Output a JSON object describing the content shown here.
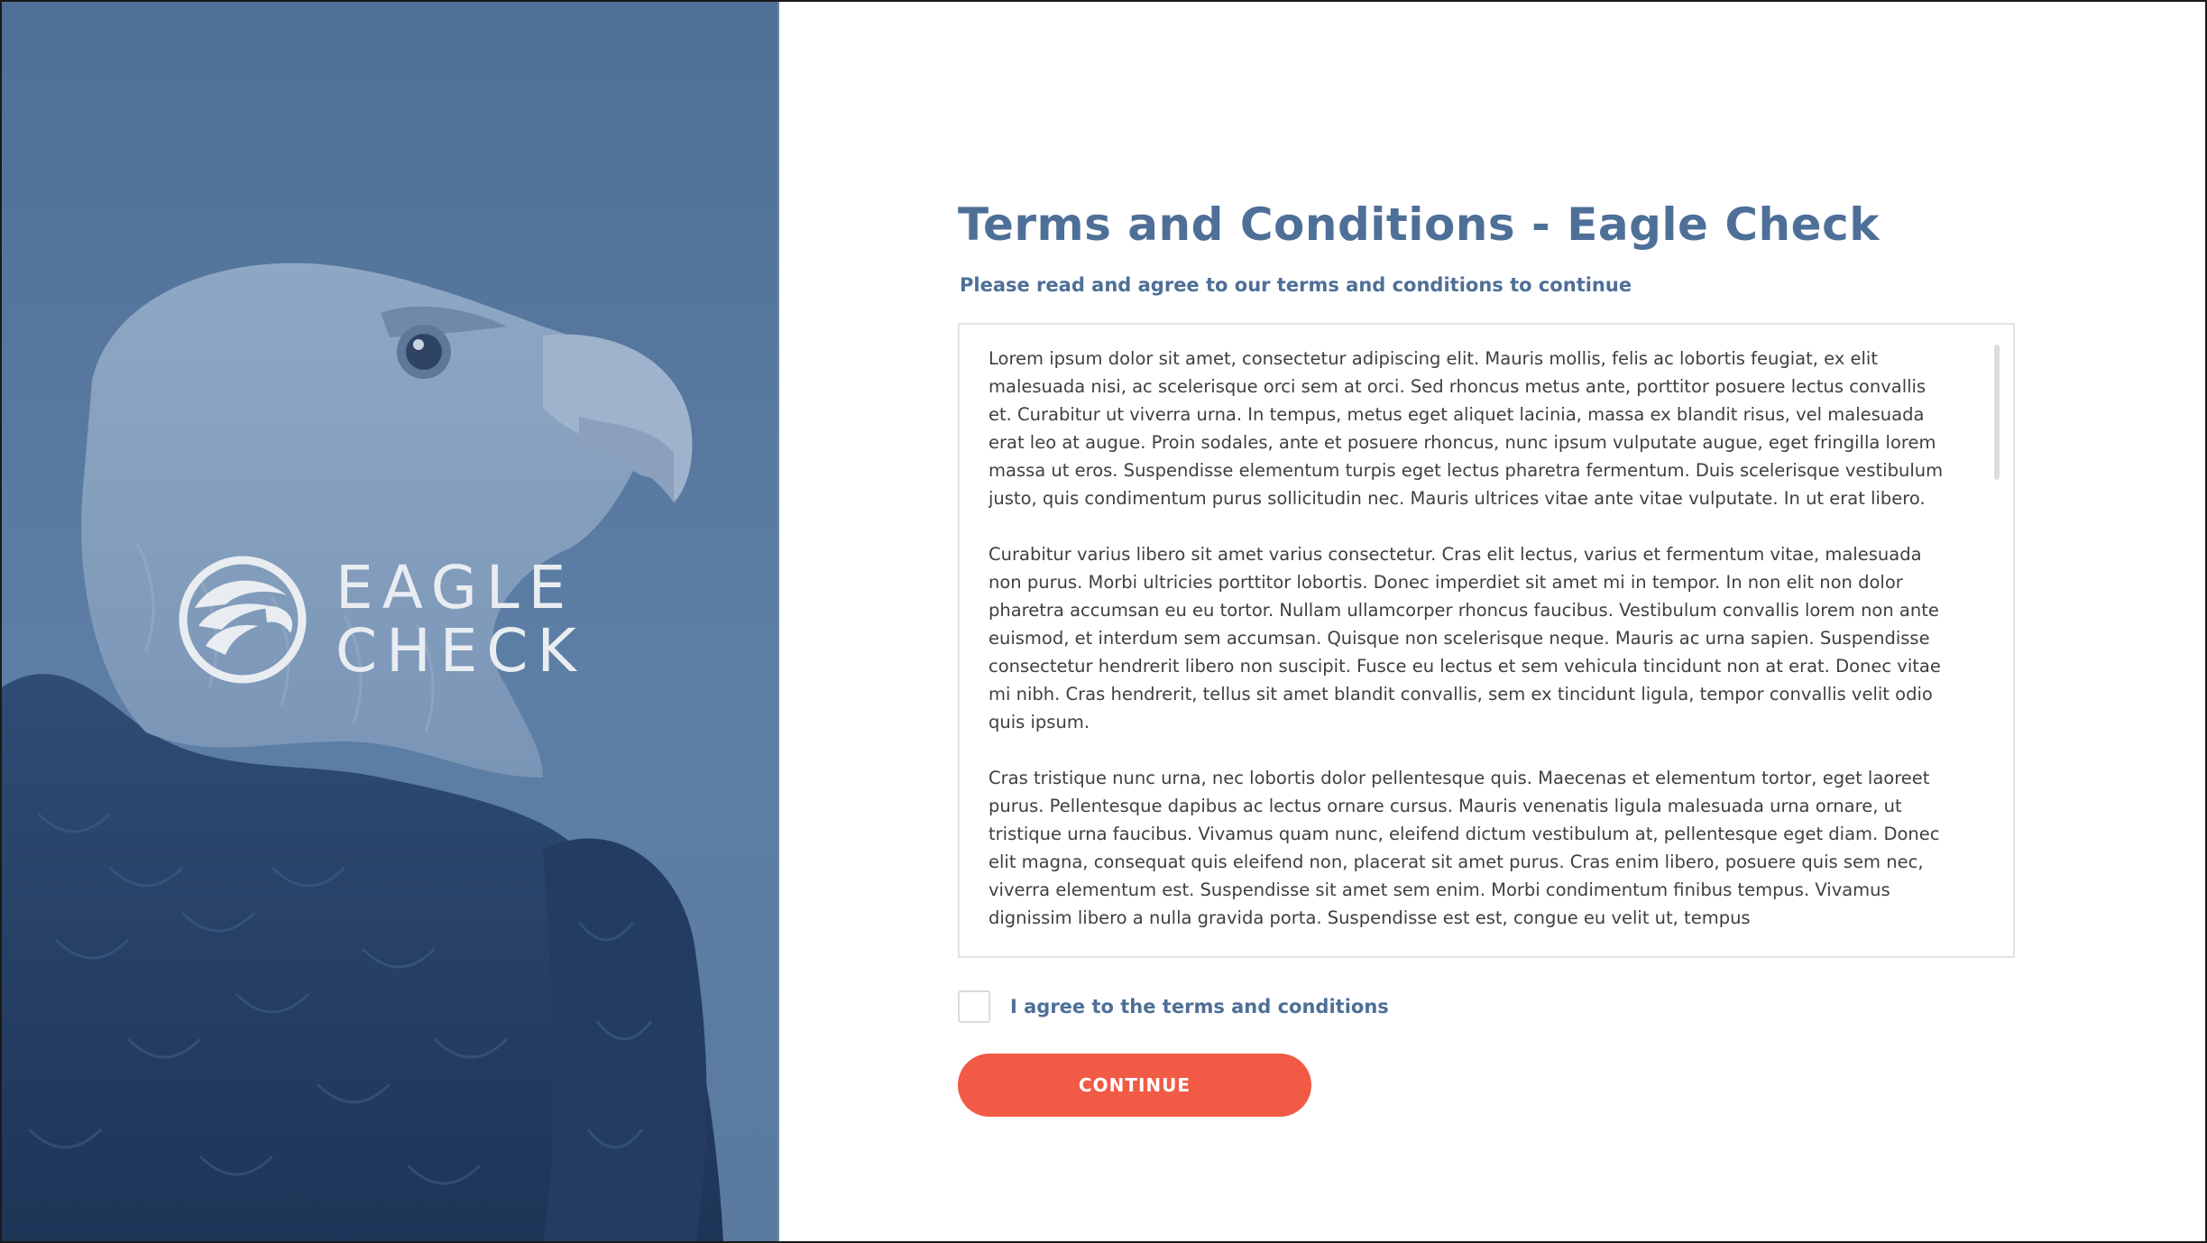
{
  "brand": {
    "logo_line1": "EAGLE",
    "logo_line2": "CHECK"
  },
  "page": {
    "title": "Terms and Conditions - Eagle Check",
    "subtitle": "Please read and agree to our terms and conditions to continue"
  },
  "terms": {
    "paragraphs": [
      "Lorem ipsum dolor sit amet, consectetur adipiscing elit. Mauris mollis, felis ac lobortis feugiat, ex elit malesuada nisi, ac scelerisque orci sem at orci. Sed rhoncus metus ante, porttitor posuere lectus convallis et. Curabitur ut viverra urna. In tempus, metus eget aliquet lacinia, massa ex blandit risus, vel malesuada erat leo at augue. Proin sodales, ante et posuere rhoncus, nunc ipsum vulputate augue, eget fringilla lorem massa ut eros. Suspendisse elementum turpis eget lectus pharetra fermentum. Duis scelerisque vestibulum justo, quis condimentum purus sollicitudin nec. Mauris ultrices vitae ante vitae vulputate. In ut erat libero.",
      "Curabitur varius libero sit amet varius consectetur. Cras elit lectus, varius et fermentum vitae, malesuada non purus. Morbi ultricies porttitor lobortis. Donec imperdiet sit amet mi in tempor. In non elit non dolor pharetra accumsan eu eu tortor. Nullam ullamcorper rhoncus faucibus. Vestibulum convallis lorem non ante euismod, et interdum sem accumsan. Quisque non scelerisque neque. Mauris ac urna sapien. Suspendisse consectetur hendrerit libero non suscipit. Fusce eu lectus et sem vehicula tincidunt non at erat. Donec vitae mi nibh. Cras hendrerit, tellus sit amet blandit convallis, sem ex tincidunt ligula, tempor convallis velit odio quis ipsum.",
      "Cras tristique nunc urna, nec lobortis dolor pellentesque quis. Maecenas et elementum tortor, eget laoreet purus. Pellentesque dapibus ac lectus ornare cursus. Mauris venenatis ligula malesuada urna ornare, ut tristique urna faucibus. Vivamus quam nunc, eleifend dictum vestibulum at, pellentesque eget diam. Donec elit magna, consequat quis eleifend non, placerat sit amet purus. Cras enim libero, posuere quis sem nec, viverra elementum est. Suspendisse sit amet sem enim. Morbi condimentum finibus tempus. Vivamus dignissim libero a nulla gravida porta. Suspendisse est est, congue eu velit ut, tempus"
    ]
  },
  "agreement": {
    "checkbox_label": "I agree to the terms and conditions",
    "checked": false
  },
  "actions": {
    "continue_label": "CONTINUE"
  },
  "colors": {
    "accent": "#4e6f97",
    "button": "#f15a44",
    "hero_tint": "#5a7aa0"
  },
  "icons": {
    "logo": "eagle-head-logo-icon"
  }
}
